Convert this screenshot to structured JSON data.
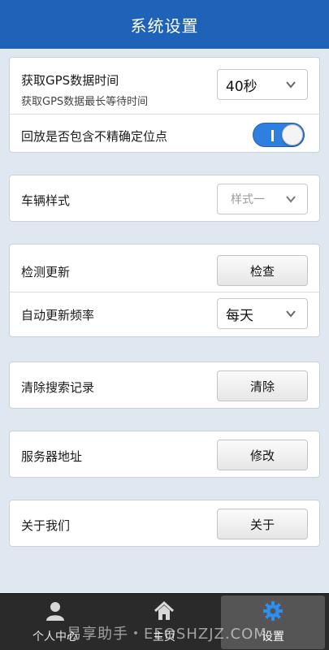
{
  "header": {
    "title": "系统设置"
  },
  "gps": {
    "label": "获取GPS数据时间",
    "sublabel": "获取GPS数据最长等待时间",
    "value": "40秒"
  },
  "playback": {
    "label": "回放是否包含不精确定位点",
    "toggle_on": true
  },
  "vehicle_style": {
    "label": "车辆样式",
    "value": "样式一"
  },
  "update": {
    "check_label": "检测更新",
    "check_button": "检查",
    "freq_label": "自动更新频率",
    "freq_value": "每天"
  },
  "search_history": {
    "label": "清除搜索记录",
    "button": "清除"
  },
  "server": {
    "label": "服务器地址",
    "button": "修改"
  },
  "about": {
    "label": "关于我们",
    "button": "关于"
  },
  "tabs": [
    {
      "label": "个人中心",
      "icon": "person-icon"
    },
    {
      "label": "主页",
      "icon": "home-icon"
    },
    {
      "label": "设置",
      "icon": "gear-icon"
    }
  ],
  "watermark": "易享助手・EEOSHZJZ.COM",
  "colors": {
    "header": "#1f63b8",
    "toggle": "#2f7fe0",
    "tabbar": "#2a2a2a"
  }
}
